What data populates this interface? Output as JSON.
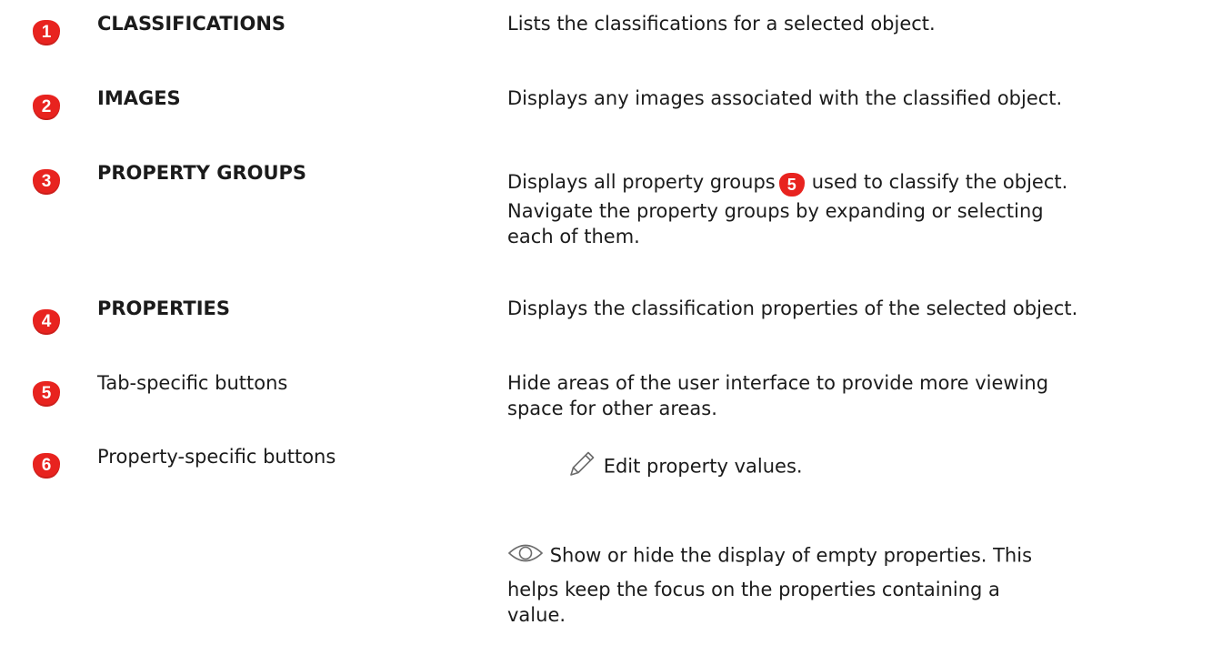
{
  "rows": [
    {
      "badge": "1",
      "term": "CLASSIFICATIONS",
      "desc": "Lists the classifications for a selected object."
    },
    {
      "badge": "2",
      "term": "IMAGES",
      "desc": "Displays any images associated with the classified object."
    },
    {
      "badge": "3",
      "term": "PROPERTY GROUPS",
      "desc_before": "Displays all property groups",
      "desc_inline_badge": "5",
      "desc_after": "used to classify the object.",
      "desc_line2": "Navigate the property groups by expanding or selecting",
      "desc_line3": "each of them."
    },
    {
      "badge": "4",
      "term": "PROPERTIES",
      "desc": "Displays the classification properties of the selected object."
    },
    {
      "badge": "5",
      "term": "Tab-specific buttons",
      "desc_line1": "Hide areas of the user interface to provide more viewing",
      "desc_line2": "space for other areas."
    },
    {
      "badge": "6",
      "term": "Property-specific buttons",
      "edit_icon": "pencil-icon",
      "edit_text": "Edit property values.",
      "eye_icon": "eye-icon",
      "eye_line1": "Show or hide the display of empty properties. This",
      "eye_line2": "helps keep the focus on the properties containing a",
      "eye_line3": "value."
    }
  ],
  "colors": {
    "badge": "#e8231f",
    "text": "#1b1b1b"
  }
}
